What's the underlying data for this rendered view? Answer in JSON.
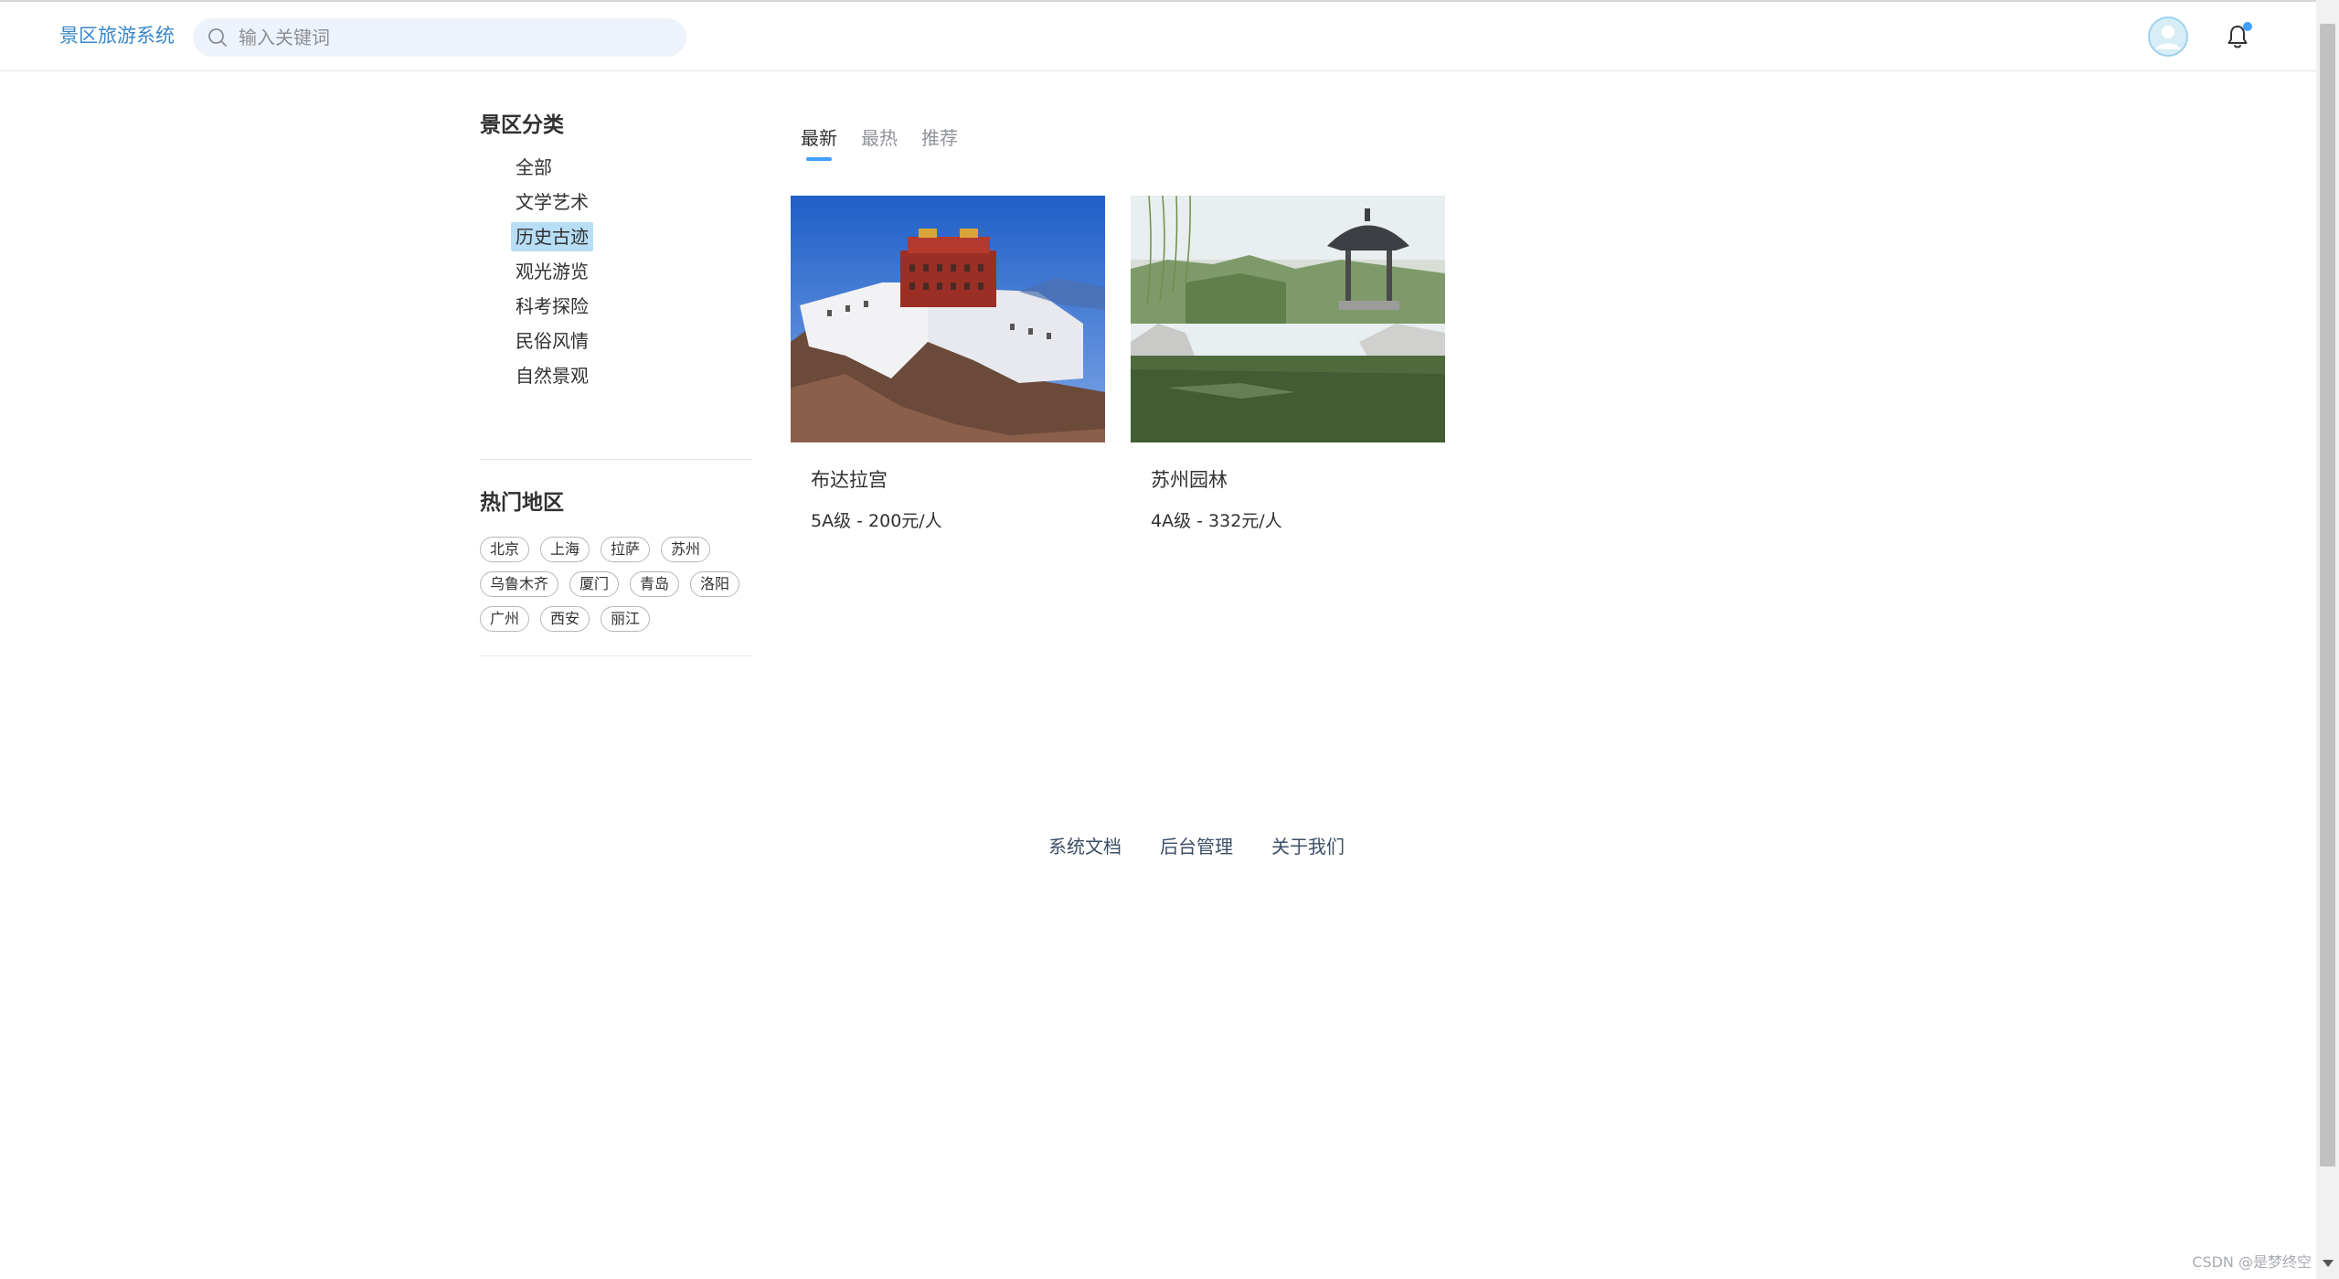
{
  "header": {
    "brand": "景区旅游系统",
    "search_placeholder": "输入关键词",
    "search_value": ""
  },
  "sidebar": {
    "category_title": "景区分类",
    "categories": [
      {
        "label": "全部",
        "active": false
      },
      {
        "label": "文学艺术",
        "active": false
      },
      {
        "label": "历史古迹",
        "active": true
      },
      {
        "label": "观光游览",
        "active": false
      },
      {
        "label": "科考探险",
        "active": false
      },
      {
        "label": "民俗风情",
        "active": false
      },
      {
        "label": "自然景观",
        "active": false
      }
    ],
    "region_title": "热门地区",
    "regions": [
      "北京",
      "上海",
      "拉萨",
      "苏州",
      "乌鲁木齐",
      "厦门",
      "青岛",
      "洛阳",
      "广州",
      "西安",
      "丽江"
    ]
  },
  "main": {
    "tabs": [
      {
        "label": "最新",
        "active": true
      },
      {
        "label": "最热",
        "active": false
      },
      {
        "label": "推荐",
        "active": false
      }
    ],
    "cards": [
      {
        "title": "布达拉宫",
        "info": "5A级 - 200元/人"
      },
      {
        "title": "苏州园林",
        "info": "4A级 - 332元/人"
      }
    ]
  },
  "footer": {
    "links": [
      "系统文档",
      "后台管理",
      "关于我们"
    ]
  },
  "watermark": "CSDN @是梦终空",
  "colors": {
    "accent": "#409eff",
    "brand": "#3a87c8",
    "active_category_bg": "#b8def6"
  },
  "icons": {
    "search": "search-icon",
    "avatar": "user-avatar-icon",
    "bell": "bell-icon"
  }
}
